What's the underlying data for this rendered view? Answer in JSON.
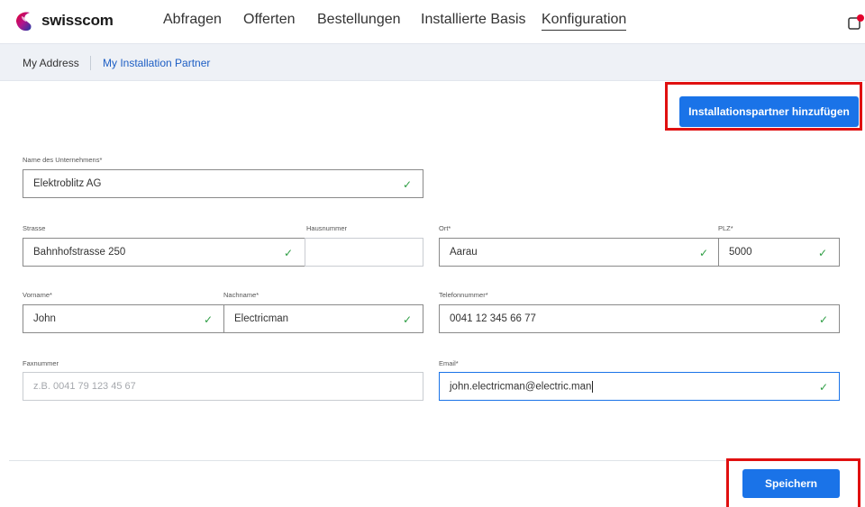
{
  "brand": {
    "name": "swisscom"
  },
  "nav": {
    "items": [
      {
        "label": "Abfragen",
        "active": false
      },
      {
        "label": "Offerten",
        "active": false
      },
      {
        "label": "Bestellungen",
        "active": false
      },
      {
        "label": "Installierte Basis",
        "active": false
      },
      {
        "label": "Konfiguration",
        "active": true
      }
    ]
  },
  "subnav": {
    "items": [
      {
        "label": "My Address",
        "active": false
      },
      {
        "label": "My Installation Partner",
        "active": true
      }
    ]
  },
  "actions": {
    "add_partner_label": "Installationspartner hinzufügen",
    "save_label": "Speichern"
  },
  "form": {
    "company": {
      "label": "Name des Unternehmens*",
      "value": "Elektroblitz AG",
      "valid": true
    },
    "street": {
      "label": "Strasse",
      "value": "Bahnhofstrasse 250",
      "valid": true
    },
    "house_number": {
      "label": "Hausnummer",
      "value": ""
    },
    "city": {
      "label": "Ort*",
      "value": "Aarau",
      "valid": true
    },
    "zip": {
      "label": "PLZ*",
      "value": "5000",
      "valid": true
    },
    "first_name": {
      "label": "Vorname*",
      "value": "John",
      "valid": true
    },
    "last_name": {
      "label": "Nachname*",
      "value": "Electricman",
      "valid": true
    },
    "phone": {
      "label": "Telefonnummer*",
      "value": "0041 12 345 66 77",
      "valid": true
    },
    "fax": {
      "label": "Faxnummer",
      "value": "",
      "placeholder": "z.B. 0041 79 123 45 67"
    },
    "email": {
      "label": "Email*",
      "value": "john.electricman@electric.man",
      "valid": true,
      "focused": true
    },
    "check_glyph": "✓"
  },
  "colors": {
    "primary": "#1a73e8",
    "valid_check": "#2e9e44",
    "highlight_box": "#e01010",
    "subnav_bg": "#eef1f6",
    "link": "#1d5ec4"
  },
  "icons": {
    "logo": "swisscom-logo-icon",
    "corner": "notification-icon"
  }
}
